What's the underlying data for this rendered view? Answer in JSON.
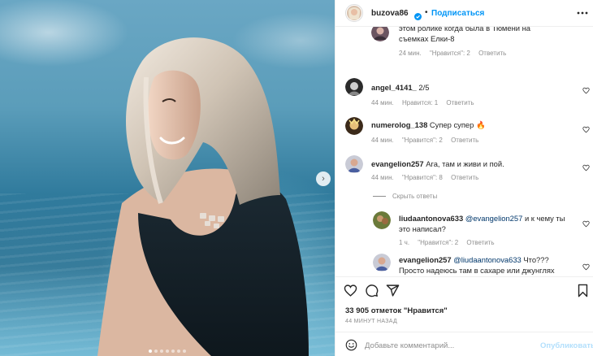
{
  "post": {
    "photo_alt": "photo",
    "carousel": {
      "total": 7,
      "active": 0
    }
  },
  "header": {
    "username": "buzova86",
    "separator": "•",
    "follow_label": "Подписаться"
  },
  "comments": [
    {
      "username": "",
      "text": "этом ролике когда была в Тюмени на съемках Елки-8",
      "time": "24 мин.",
      "likes": "\"Нравится\": 2",
      "reply": "Ответить"
    },
    {
      "username": "angel_4141_",
      "text": "2/5",
      "time": "44 мин.",
      "likes": "Нравится: 1",
      "reply": "Ответить"
    },
    {
      "username": "numerolog_138",
      "text": "Супер супер 🔥",
      "time": "44 мин.",
      "likes": "\"Нравится\": 2",
      "reply": "Ответить"
    },
    {
      "username": "evangelion257",
      "text": "Ага, там и живи и пой.",
      "time": "44 мин.",
      "likes": "\"Нравится\": 8",
      "reply": "Ответить"
    }
  ],
  "hide_replies_label": "Скрыть ответы",
  "replies": [
    {
      "username": "liudaantonova633",
      "mention": "@evangelion257",
      "text": "и к чему ты это написал?",
      "time": "1 ч.",
      "likes": "\"Нравится\": 2",
      "reply": "Ответить"
    },
    {
      "username": "evangelion257",
      "mention": "@liudaantonova633",
      "text": "Что??? Просто надеюсь там в сахаре или джунглях заблудится)))",
      "time": "",
      "likes": "",
      "reply": ""
    }
  ],
  "footer": {
    "likes_count": "33 905 отметок \"Нравится\"",
    "time_ago": "44 МИНУТ НАЗАД",
    "comment_placeholder": "Добавьте комментарий...",
    "publish_label": "Опубликовать"
  },
  "colors": {
    "accent": "#0095f6",
    "publish_disabled": "#b2dffc",
    "secondary_text": "#8e8e8e",
    "text": "#262626"
  },
  "icons": {
    "like": "heart-icon",
    "comment": "comment-icon",
    "share": "share-icon",
    "save": "bookmark-icon",
    "more": "more-icon",
    "emoji": "emoji-icon",
    "verified": "verified-badge-icon",
    "next": "chevron-right-icon"
  }
}
